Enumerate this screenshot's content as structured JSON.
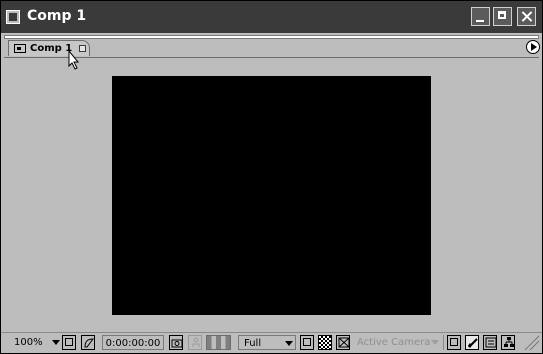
{
  "window": {
    "title": "Comp 1",
    "controls": [
      "minimize",
      "maximize",
      "close"
    ]
  },
  "tabs": [
    {
      "label": "Comp 1",
      "icon": "composition-icon"
    }
  ],
  "statusbar": {
    "zoom": "100%",
    "timecode": "0:00:00:00",
    "resolution": "Full",
    "view": "Active Camera"
  },
  "colors": {
    "titlebar": "#3a3a3a",
    "panel": "#bdbdbd",
    "viewer": "#000000",
    "inactive_text": "#8f8f8f"
  }
}
